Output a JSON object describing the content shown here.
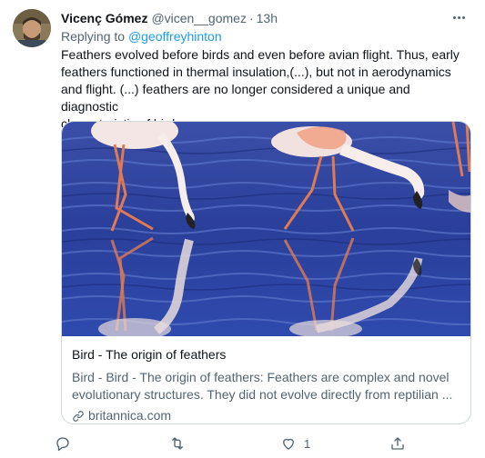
{
  "author": {
    "name": "Vicenç Gómez",
    "handle": "@vicen__gomez",
    "separator": "·",
    "time": "13h"
  },
  "reply": {
    "prefix": "Replying to ",
    "target": "@geoffreyhinton"
  },
  "tweet": {
    "line1": "Feathers evolved before birds and even before avian flight. Thus, early",
    "line2": "feathers functioned in thermal insulation,(...), but not in aerodynamics",
    "line3": "and flight. (...) feathers are no longer considered a unique and diagnostic",
    "line4": "characteristic of birds."
  },
  "card": {
    "title": "Bird - The origin of feathers",
    "desc_line1": "Bird - Bird - The origin of feathers: Feathers are complex and novel",
    "desc_line2": "evolutionary structures. They did not evolve directly from reptilian ...",
    "domain": "britannica.com"
  },
  "actions": {
    "reply_count": "",
    "retweet_count": "",
    "like_count": "1",
    "share_count": ""
  },
  "colors": {
    "accent": "#1d9bf0",
    "secondary_text": "#536471",
    "border": "#cfd9de"
  },
  "icons": [
    "more-icon",
    "reply-icon",
    "retweet-icon",
    "like-icon",
    "share-icon",
    "link-icon"
  ]
}
